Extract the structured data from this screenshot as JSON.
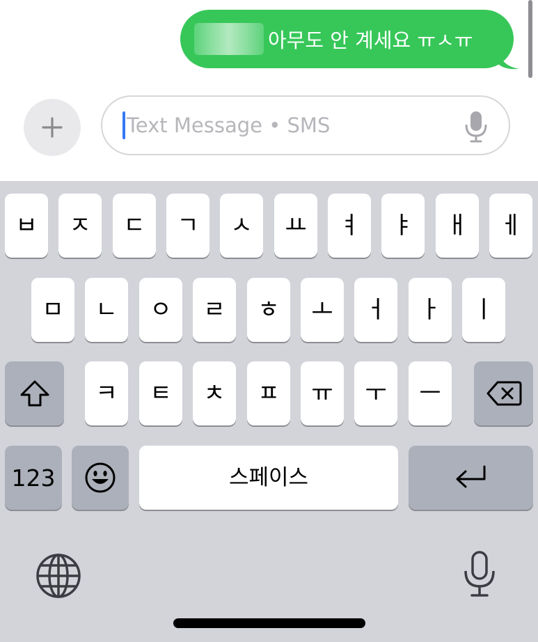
{
  "conversation": {
    "message_text": "아무도 안 계세요 ㅠㅅㅠ",
    "bubble_color": "#37c759"
  },
  "compose": {
    "placeholder": "Text Message • SMS",
    "plus_icon": "plus-icon",
    "mic_icon": "microphone-icon"
  },
  "keyboard": {
    "row1": [
      "ㅂ",
      "ㅈ",
      "ㄷ",
      "ㄱ",
      "ㅅ",
      "ㅛ",
      "ㅕ",
      "ㅑ",
      "ㅐ",
      "ㅔ"
    ],
    "row2": [
      "ㅁ",
      "ㄴ",
      "ㅇ",
      "ㄹ",
      "ㅎ",
      "ㅗ",
      "ㅓ",
      "ㅏ",
      "ㅣ"
    ],
    "row3": [
      "ㅋ",
      "ㅌ",
      "ㅊ",
      "ㅍ",
      "ㅠ",
      "ㅜ",
      "ㅡ"
    ],
    "numbers_label": "123",
    "space_label": "스페이스",
    "shift_icon": "shift-icon",
    "delete_icon": "delete-icon",
    "emoji_icon": "emoji-icon",
    "return_icon": "return-icon",
    "globe_icon": "globe-icon",
    "dictation_icon": "microphone-icon"
  }
}
